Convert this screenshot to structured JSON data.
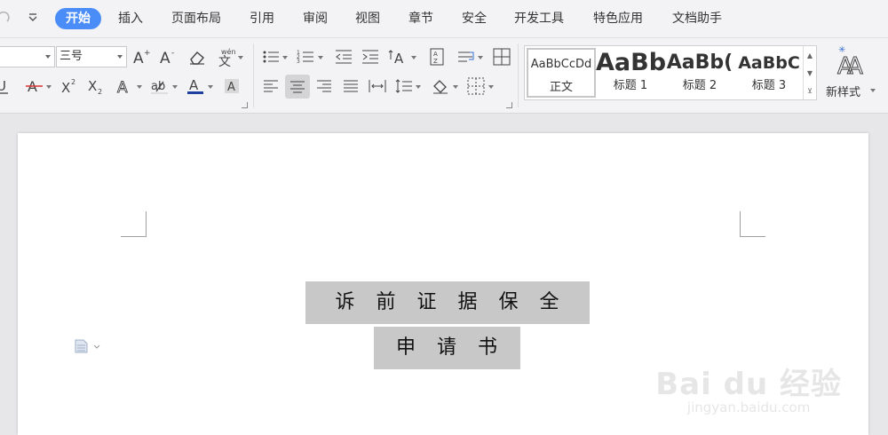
{
  "menubar": {
    "tabs": [
      "开始",
      "插入",
      "页面布局",
      "引用",
      "审阅",
      "视图",
      "章节",
      "安全",
      "开发工具",
      "特色应用",
      "文档助手"
    ]
  },
  "ribbon": {
    "font_name": "",
    "font_size": "三号",
    "styles": [
      {
        "sample": "AaBbCcDd",
        "name": "正文"
      },
      {
        "sample": "AaBb",
        "name": "标题 1"
      },
      {
        "sample": "AaBb(",
        "name": "标题 2"
      },
      {
        "sample": "AaBbC",
        "name": "标题 3"
      }
    ],
    "new_style_label": "新样式"
  },
  "document": {
    "line1": "诉　前　证　据　保　全",
    "line2": "申　请　书"
  },
  "watermark": {
    "big": "Bai du 经验",
    "small": "jingyan.baidu.com"
  },
  "colors": {
    "accent": "#4a8df8",
    "highlight": "#c8c8c8",
    "font_color_bar": "#1f3fa0"
  }
}
